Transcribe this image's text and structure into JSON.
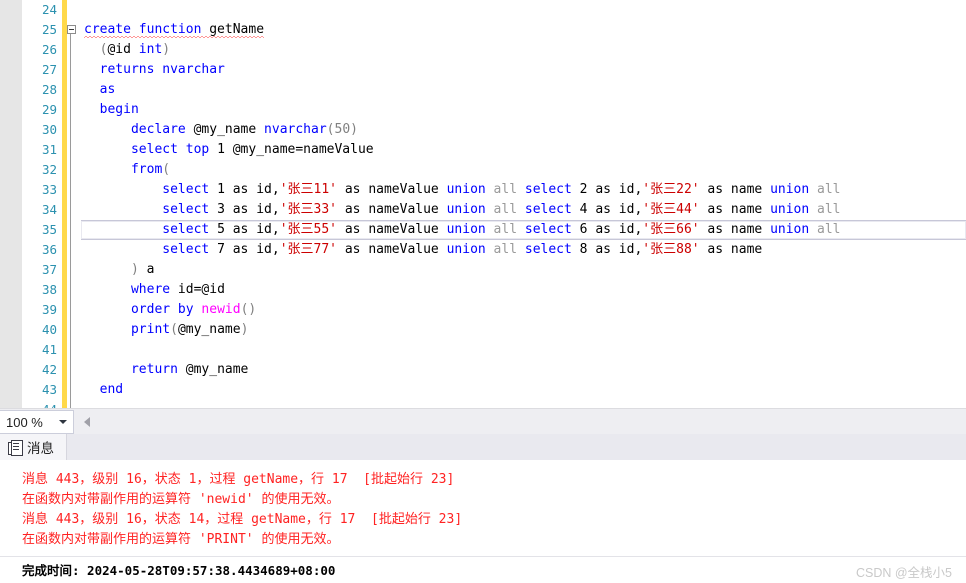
{
  "editor": {
    "first_visible_line": 24,
    "current_line": 35,
    "lines": [
      {
        "n": 24,
        "tokens": []
      },
      {
        "n": 25,
        "fold": true,
        "squiggle": true,
        "tokens": [
          {
            "t": "create function",
            "c": "kw"
          },
          {
            "t": " ",
            "c": "plain"
          },
          {
            "t": "getName",
            "c": "plain"
          }
        ]
      },
      {
        "n": 26,
        "tokens": [
          {
            "t": "  ",
            "c": "plain"
          },
          {
            "t": "(",
            "c": "punct"
          },
          {
            "t": "@id ",
            "c": "plain"
          },
          {
            "t": "int",
            "c": "kw"
          },
          {
            "t": ")",
            "c": "punct"
          }
        ]
      },
      {
        "n": 27,
        "tokens": [
          {
            "t": "  ",
            "c": "plain"
          },
          {
            "t": "returns nvarchar",
            "c": "kw"
          }
        ]
      },
      {
        "n": 28,
        "tokens": [
          {
            "t": "  ",
            "c": "plain"
          },
          {
            "t": "as",
            "c": "kw"
          }
        ]
      },
      {
        "n": 29,
        "tokens": [
          {
            "t": "  ",
            "c": "plain"
          },
          {
            "t": "begin",
            "c": "kw"
          }
        ]
      },
      {
        "n": 30,
        "tokens": [
          {
            "t": "      ",
            "c": "plain"
          },
          {
            "t": "declare",
            "c": "kw"
          },
          {
            "t": " @my_name ",
            "c": "plain"
          },
          {
            "t": "nvarchar",
            "c": "kw"
          },
          {
            "t": "(50)",
            "c": "punct"
          }
        ]
      },
      {
        "n": 31,
        "tokens": [
          {
            "t": "      ",
            "c": "plain"
          },
          {
            "t": "select top",
            "c": "kw"
          },
          {
            "t": " 1 @my_name=nameValue",
            "c": "plain"
          }
        ]
      },
      {
        "n": 32,
        "tokens": [
          {
            "t": "      ",
            "c": "plain"
          },
          {
            "t": "from",
            "c": "kw"
          },
          {
            "t": "(",
            "c": "punct"
          }
        ]
      },
      {
        "n": 33,
        "tokens": [
          {
            "t": "          ",
            "c": "plain"
          },
          {
            "t": "select",
            "c": "kw"
          },
          {
            "t": " 1 as id,",
            "c": "plain"
          },
          {
            "t": "'张三11'",
            "c": "str"
          },
          {
            "t": " as nameValue ",
            "c": "plain"
          },
          {
            "t": "union",
            "c": "kw"
          },
          {
            "t": " all ",
            "c": "gray"
          },
          {
            "t": "select",
            "c": "kw"
          },
          {
            "t": " 2 as id,",
            "c": "plain"
          },
          {
            "t": "'张三22'",
            "c": "str"
          },
          {
            "t": " as name ",
            "c": "plain"
          },
          {
            "t": "union",
            "c": "kw"
          },
          {
            "t": " all",
            "c": "gray"
          }
        ]
      },
      {
        "n": 34,
        "tokens": [
          {
            "t": "          ",
            "c": "plain"
          },
          {
            "t": "select",
            "c": "kw"
          },
          {
            "t": " 3 as id,",
            "c": "plain"
          },
          {
            "t": "'张三33'",
            "c": "str"
          },
          {
            "t": " as nameValue ",
            "c": "plain"
          },
          {
            "t": "union",
            "c": "kw"
          },
          {
            "t": " all ",
            "c": "gray"
          },
          {
            "t": "select",
            "c": "kw"
          },
          {
            "t": " 4 as id,",
            "c": "plain"
          },
          {
            "t": "'张三44'",
            "c": "str"
          },
          {
            "t": " as name ",
            "c": "plain"
          },
          {
            "t": "union",
            "c": "kw"
          },
          {
            "t": " all",
            "c": "gray"
          }
        ]
      },
      {
        "n": 35,
        "current": true,
        "tokens": [
          {
            "t": "          ",
            "c": "plain"
          },
          {
            "t": "select",
            "c": "kw"
          },
          {
            "t": " 5 as id,",
            "c": "plain"
          },
          {
            "t": "'张三55'",
            "c": "str"
          },
          {
            "t": " as nameValue ",
            "c": "plain"
          },
          {
            "t": "union",
            "c": "kw"
          },
          {
            "t": " all ",
            "c": "gray"
          },
          {
            "t": "select",
            "c": "kw"
          },
          {
            "t": " 6 as id,",
            "c": "plain"
          },
          {
            "t": "'张三66'",
            "c": "str"
          },
          {
            "t": " as name ",
            "c": "plain"
          },
          {
            "t": "union",
            "c": "kw"
          },
          {
            "t": " all",
            "c": "gray"
          }
        ]
      },
      {
        "n": 36,
        "tokens": [
          {
            "t": "          ",
            "c": "plain"
          },
          {
            "t": "select",
            "c": "kw"
          },
          {
            "t": " 7 as id,",
            "c": "plain"
          },
          {
            "t": "'张三77'",
            "c": "str"
          },
          {
            "t": " as nameValue ",
            "c": "plain"
          },
          {
            "t": "union",
            "c": "kw"
          },
          {
            "t": " all ",
            "c": "gray"
          },
          {
            "t": "select",
            "c": "kw"
          },
          {
            "t": " 8 as id,",
            "c": "plain"
          },
          {
            "t": "'张三88'",
            "c": "str"
          },
          {
            "t": " as name",
            "c": "plain"
          }
        ]
      },
      {
        "n": 37,
        "tokens": [
          {
            "t": "      ",
            "c": "plain"
          },
          {
            "t": ")",
            "c": "punct"
          },
          {
            "t": " a",
            "c": "plain"
          }
        ]
      },
      {
        "n": 38,
        "tokens": [
          {
            "t": "      ",
            "c": "plain"
          },
          {
            "t": "where",
            "c": "kw"
          },
          {
            "t": " id=@id",
            "c": "plain"
          }
        ]
      },
      {
        "n": 39,
        "tokens": [
          {
            "t": "      ",
            "c": "plain"
          },
          {
            "t": "order by",
            "c": "kw"
          },
          {
            "t": " ",
            "c": "plain"
          },
          {
            "t": "newid",
            "c": "fn"
          },
          {
            "t": "()",
            "c": "punct"
          }
        ]
      },
      {
        "n": 40,
        "tokens": [
          {
            "t": "      ",
            "c": "plain"
          },
          {
            "t": "print",
            "c": "kw"
          },
          {
            "t": "(",
            "c": "punct"
          },
          {
            "t": "@my_name",
            "c": "plain"
          },
          {
            "t": ")",
            "c": "punct"
          }
        ]
      },
      {
        "n": 41,
        "tokens": []
      },
      {
        "n": 42,
        "tokens": [
          {
            "t": "      ",
            "c": "plain"
          },
          {
            "t": "return",
            "c": "kw"
          },
          {
            "t": " @my_name",
            "c": "plain"
          }
        ]
      },
      {
        "n": 43,
        "tokens": [
          {
            "t": "  ",
            "c": "plain"
          },
          {
            "t": "end",
            "c": "kw"
          }
        ]
      },
      {
        "n": 44,
        "tokens": []
      }
    ]
  },
  "zoombar": {
    "zoom_level": "100 %",
    "caret_icon": "chevron-down-icon",
    "scroll_left_icon": "scroll-left-arrow-icon"
  },
  "results": {
    "tab_label": "消息",
    "tab_icon": "messages-icon",
    "messages": [
      "消息 443，级别 16，状态 1，过程 getName，行 17  [批起始行 23]",
      "在函数内对带副作用的运算符 'newid' 的使用无效。",
      "消息 443，级别 16，状态 14，过程 getName，行 17  [批起始行 23]",
      "在函数内对带副作用的运算符 'PRINT' 的使用无效。"
    ],
    "status_text": "完成时间: 2024-05-28T09:57:38.4434689+08:00",
    "watermark": "CSDN @全栈小5"
  },
  "colors": {
    "keyword": "#0000ff",
    "string": "#cc0000",
    "function": "#ff00ff",
    "comment_gray": "#9a9a9a",
    "linenumber": "#2b91af",
    "changebar": "#ffd94a",
    "error": "#ff2222"
  }
}
